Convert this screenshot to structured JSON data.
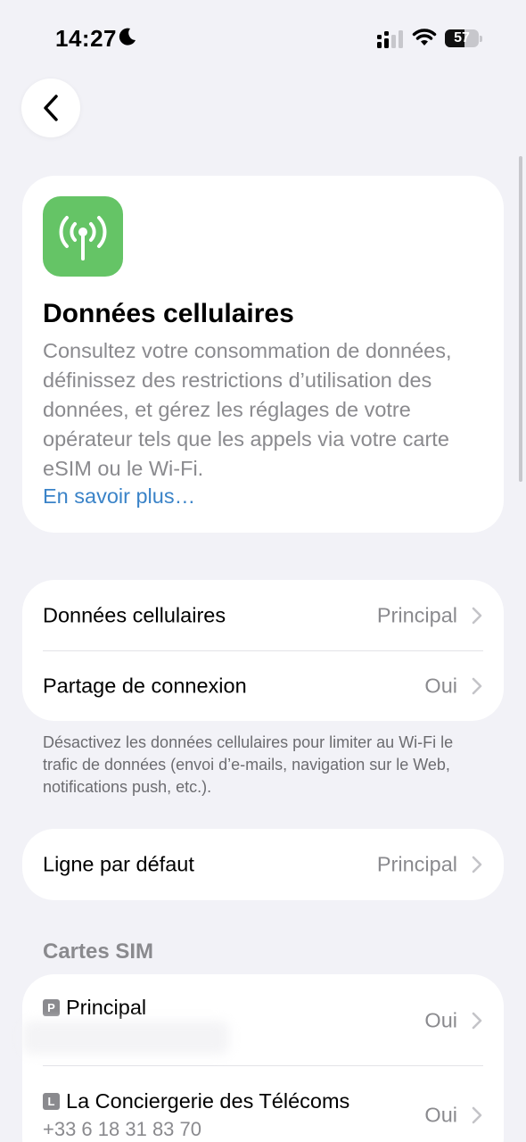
{
  "status_bar": {
    "time": "14:27",
    "battery_level": "57",
    "battery_fraction": 0.57
  },
  "intro": {
    "title": "Données cellulaires",
    "description": "Consultez votre consommation de données, définissez des restrictions d’utilisation des données, et gérez les réglages de votre opérateur tels que les appels via votre carte eSIM ou le Wi-Fi.",
    "link": "En savoir plus…",
    "icon": "cellular-antenna-icon",
    "icon_color": "#65c466",
    "link_color": "#3a83c8"
  },
  "data_section": {
    "rows": [
      {
        "label": "Données cellulaires",
        "value": "Principal"
      },
      {
        "label": "Partage de connexion",
        "value": "Oui"
      }
    ],
    "footnote": "Désactivez les données cellulaires pour limiter au Wi-Fi le trafic de données (envoi d’e-mails, navigation sur le Web, notifications push, etc.)."
  },
  "default_line": {
    "label": "Ligne par défaut",
    "value": "Principal"
  },
  "sim_section": {
    "title": "Cartes SIM",
    "sims": [
      {
        "badge": "P",
        "name": "Principal",
        "number": "",
        "value": "Oui"
      },
      {
        "badge": "L",
        "name": "La Conciergerie des Télécoms",
        "number": "+33 6 18 31 83 70",
        "value": "Oui"
      }
    ]
  }
}
